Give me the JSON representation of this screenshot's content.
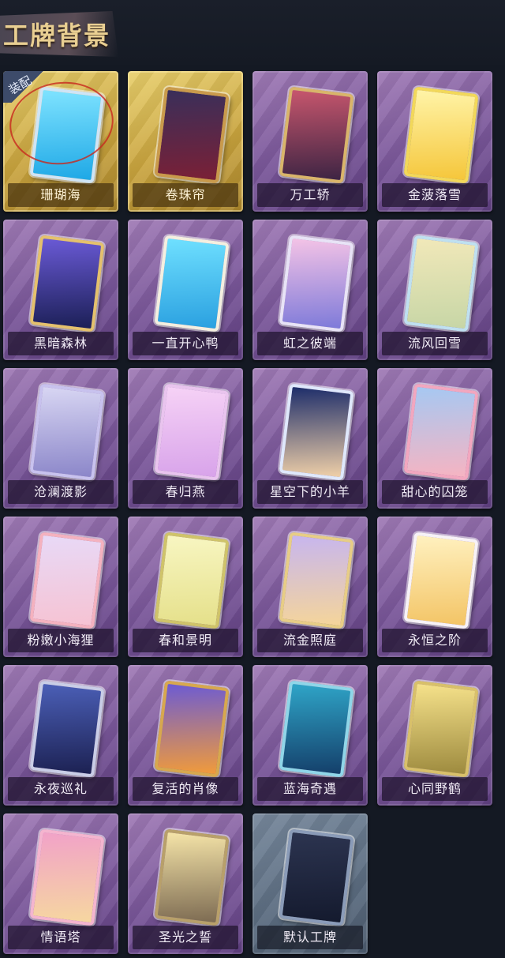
{
  "header": {
    "title": "工牌背景"
  },
  "equipped_badge": "装配",
  "cards": [
    {
      "label": "珊瑚海",
      "frame": "gold",
      "art": [
        "#7fe3ff",
        "#1ea8e6"
      ],
      "border": "#cfe4f5",
      "equipped": true
    },
    {
      "label": "卷珠帘",
      "frame": "gold",
      "art": [
        "#3a2f5a",
        "#7a2036"
      ],
      "border": "#c99a4c",
      "equipped": false
    },
    {
      "label": "万工轿",
      "frame": "purple",
      "art": [
        "#c7566d",
        "#3d2443"
      ],
      "border": "#d9b56a",
      "equipped": false
    },
    {
      "label": "金菠落雪",
      "frame": "purple",
      "art": [
        "#fff4a8",
        "#f5c63a"
      ],
      "border": "#f2d85a",
      "equipped": false
    },
    {
      "label": "黑暗森林",
      "frame": "purple",
      "art": [
        "#6a5ad6",
        "#1b1f56"
      ],
      "border": "#e4c16d",
      "equipped": false
    },
    {
      "label": "一直开心鸭",
      "frame": "purple",
      "art": [
        "#6fe0ff",
        "#2aa0e0"
      ],
      "border": "#f4efe0",
      "equipped": false
    },
    {
      "label": "虹之彼端",
      "frame": "purple",
      "art": [
        "#f4c3e6",
        "#7e7ad9"
      ],
      "border": "#e8e3f6",
      "equipped": false
    },
    {
      "label": "流风回雪",
      "frame": "purple",
      "art": [
        "#f1e8b9",
        "#c7d6a6"
      ],
      "border": "#bfe0f0",
      "equipped": false
    },
    {
      "label": "沧澜渡影",
      "frame": "purple",
      "art": [
        "#d8d6f3",
        "#8b86c9"
      ],
      "border": "#c8c2ee",
      "equipped": false
    },
    {
      "label": "春归燕",
      "frame": "purple",
      "art": [
        "#f6d2f6",
        "#d8a3ea"
      ],
      "border": "#e9c4ee",
      "equipped": false
    },
    {
      "label": "星空下的小羊",
      "frame": "purple",
      "art": [
        "#1d2d6a",
        "#f0d0a8"
      ],
      "border": "#dfe8fb",
      "equipped": false
    },
    {
      "label": "甜心的囚笼",
      "frame": "purple",
      "art": [
        "#a6c8f2",
        "#f6b4c2"
      ],
      "border": "#f2a7bf",
      "equipped": false
    },
    {
      "label": "粉嫩小海狸",
      "frame": "purple",
      "art": [
        "#e8d9f7",
        "#f6c3d3"
      ],
      "border": "#f4b2bf",
      "equipped": false
    },
    {
      "label": "春和景明",
      "frame": "purple",
      "art": [
        "#f8f6c2",
        "#e5e08a"
      ],
      "border": "#cfc36a",
      "equipped": false
    },
    {
      "label": "流金照庭",
      "frame": "purple",
      "art": [
        "#c7b6ef",
        "#f5d59a"
      ],
      "border": "#e7cd86",
      "equipped": false
    },
    {
      "label": "永恒之阶",
      "frame": "purple",
      "art": [
        "#fff1c0",
        "#f3c465"
      ],
      "border": "#f7f2f7",
      "equipped": false
    },
    {
      "label": "永夜巡礼",
      "frame": "purple",
      "art": [
        "#4b5fb7",
        "#1c2152"
      ],
      "border": "#c9cde6",
      "equipped": false
    },
    {
      "label": "复活的肖像",
      "frame": "purple",
      "art": [
        "#6c5bd3",
        "#f19b3a"
      ],
      "border": "#d7a84e",
      "equipped": false
    },
    {
      "label": "蓝海奇遇",
      "frame": "purple",
      "art": [
        "#2fa5c8",
        "#143f6a"
      ],
      "border": "#8fd6e8",
      "equipped": false
    },
    {
      "label": "心同野鹤",
      "frame": "purple",
      "art": [
        "#f6e28b",
        "#9d8a3e"
      ],
      "border": "#d8c06a",
      "equipped": false
    },
    {
      "label": "情语塔",
      "frame": "purple",
      "art": [
        "#f1a2c8",
        "#f6d7a0"
      ],
      "border": "#f4b5cf",
      "equipped": false
    },
    {
      "label": "圣光之誓",
      "frame": "purple",
      "art": [
        "#f5e4a8",
        "#7d6b52"
      ],
      "border": "#b8a06a",
      "equipped": false
    },
    {
      "label": "默认工牌",
      "frame": "gray",
      "art": [
        "#2c3450",
        "#141a2e"
      ],
      "border": "#8a9bb8",
      "equipped": false
    }
  ]
}
